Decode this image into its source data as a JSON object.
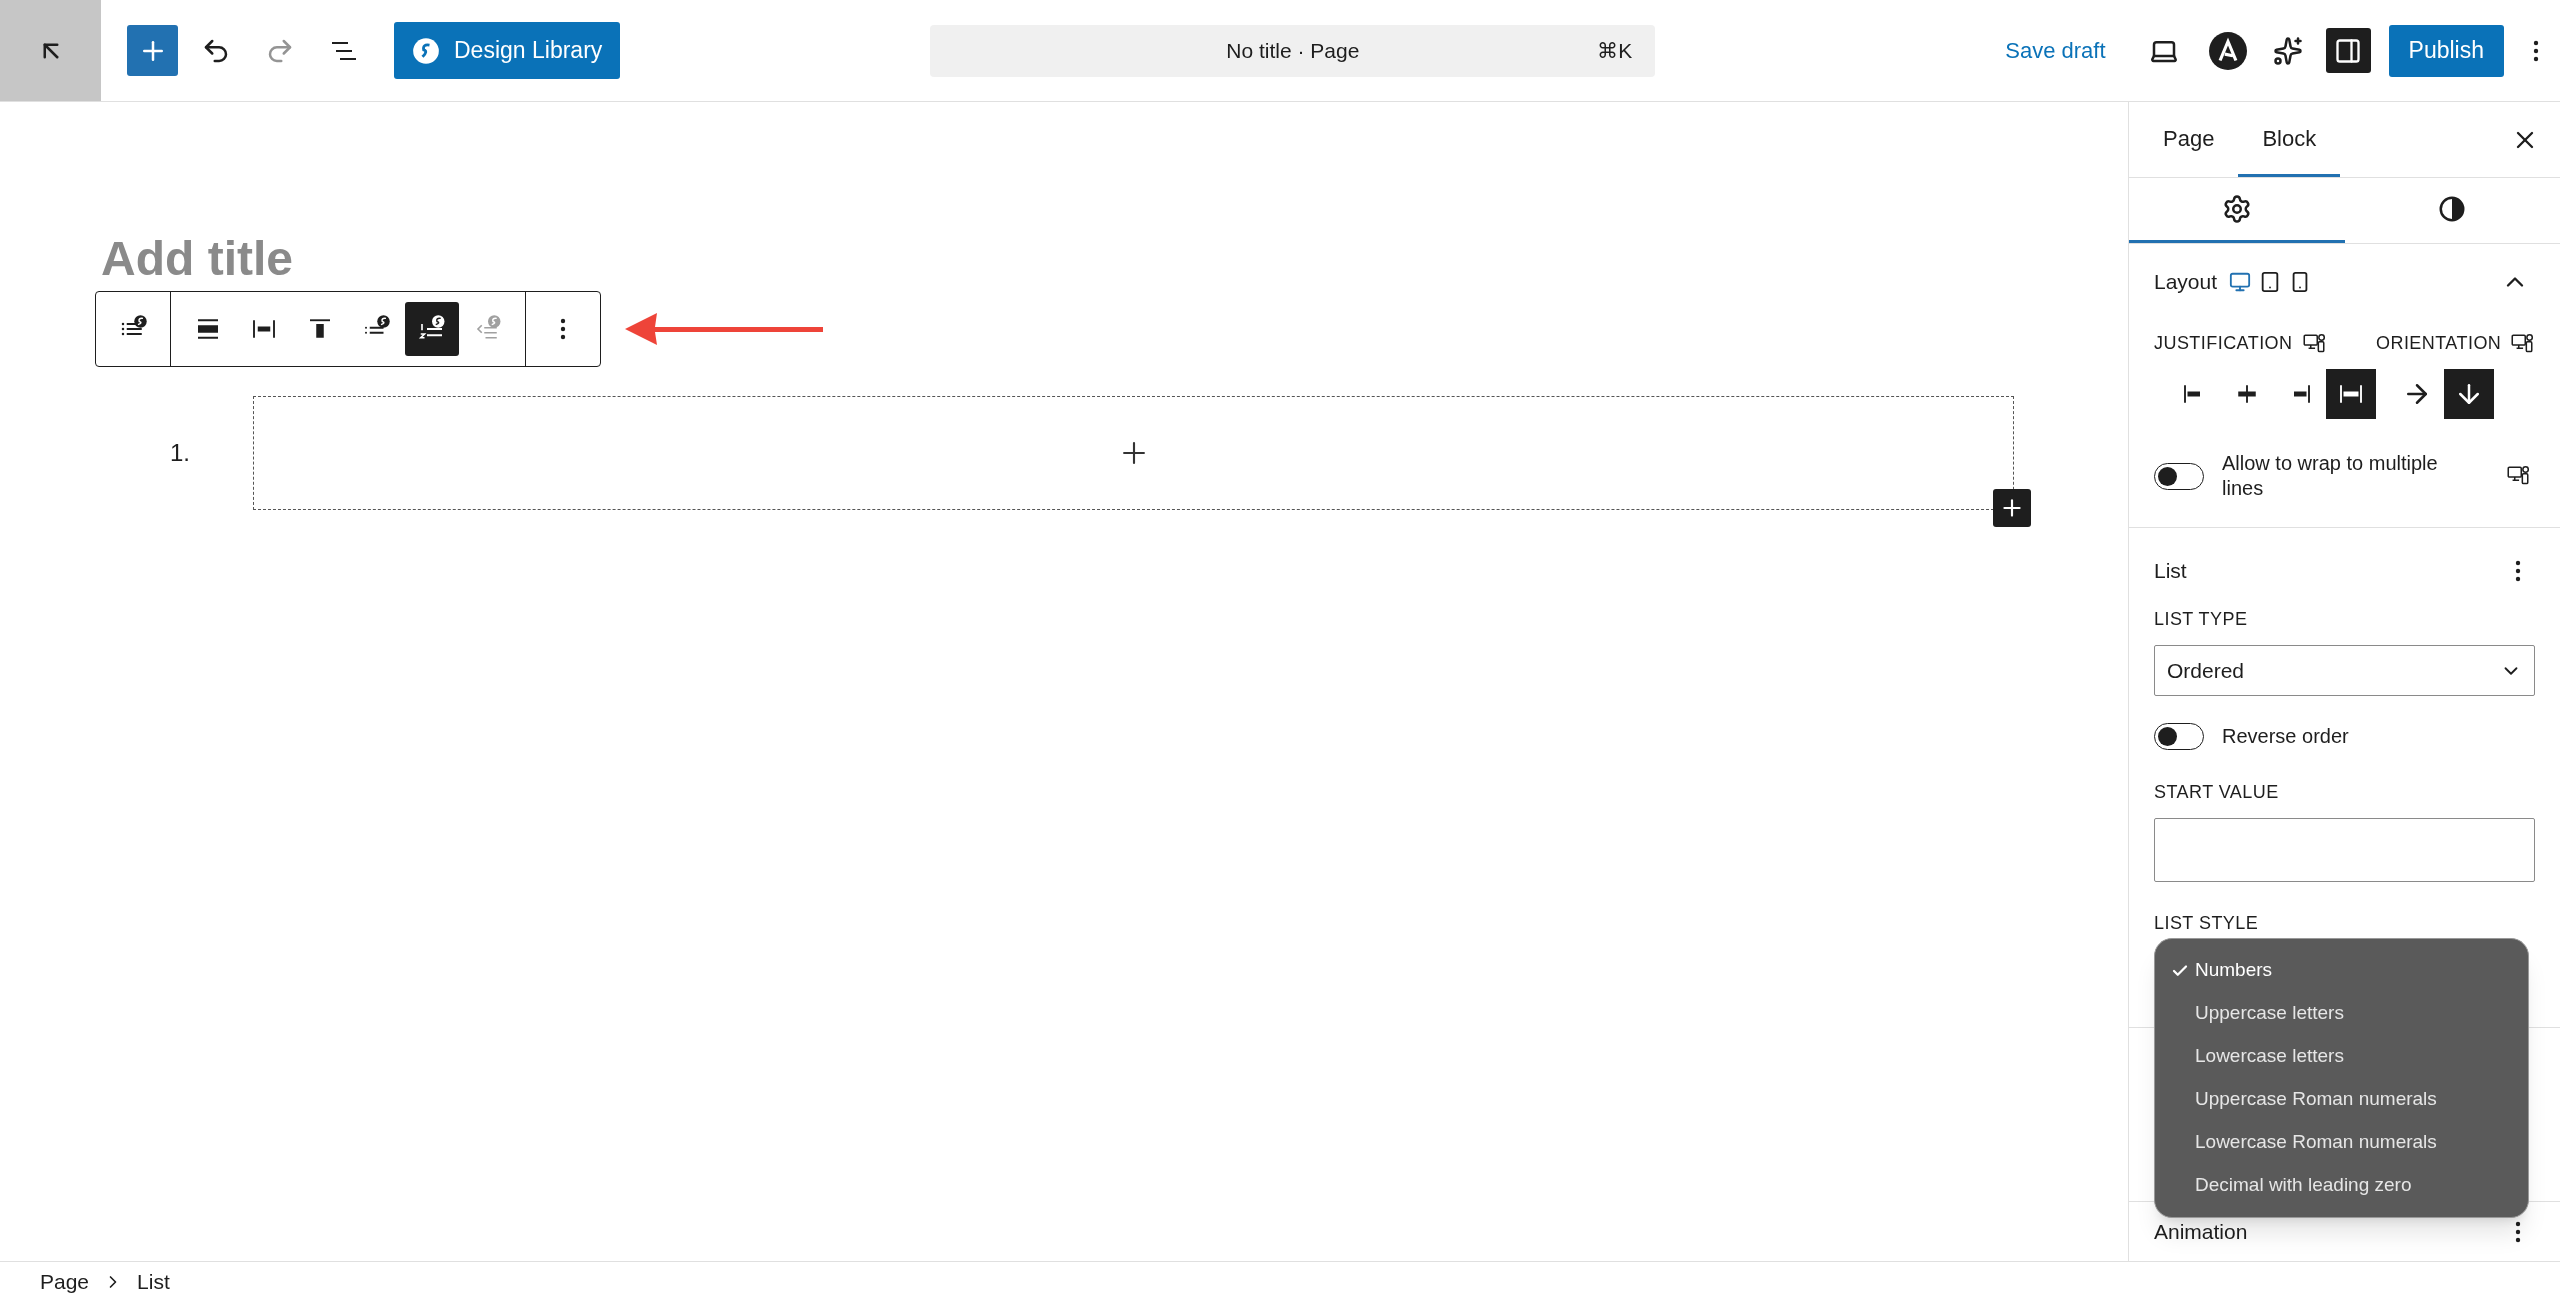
{
  "top_bar": {
    "design_library": "Design Library",
    "command_bar": {
      "title": "No title · Page",
      "shortcut": "⌘K"
    },
    "save_draft": "Save draft",
    "sidebar_toggle": {
      "selected": true
    },
    "publish": "Publish"
  },
  "editor": {
    "title_placeholder": "Add title",
    "block_toolbar": {
      "groups": [
        {
          "tools": [
            {
              "kind": "block-type",
              "selected": false,
              "disabled": false
            }
          ]
        },
        {
          "tools": [
            {
              "kind": "wide-bar",
              "selected": false,
              "disabled": false
            },
            {
              "kind": "spaced-bar",
              "selected": false,
              "disabled": false
            },
            {
              "kind": "top-bar",
              "selected": false,
              "disabled": false
            },
            {
              "kind": "unordered",
              "selected": false,
              "disabled": false
            },
            {
              "kind": "ordered",
              "selected": true,
              "disabled": false
            },
            {
              "kind": "outdent",
              "selected": false,
              "disabled": true
            }
          ]
        },
        {
          "tools": [
            {
              "kind": "more",
              "selected": false,
              "disabled": false
            }
          ]
        }
      ]
    },
    "list_items": [
      {
        "marker": "1."
      }
    ]
  },
  "sidebar": {
    "tabs": [
      {
        "label": "Page",
        "selected": false
      },
      {
        "label": "Block",
        "selected": true
      }
    ],
    "icon_tabs": [
      {
        "kind": "settings",
        "selected": true
      },
      {
        "kind": "styles",
        "selected": false
      }
    ],
    "layout": {
      "title": "Layout",
      "expanded": true,
      "devices": [
        {
          "kind": "desktop",
          "selected": true
        },
        {
          "kind": "tablet",
          "selected": false
        },
        {
          "kind": "mobile",
          "selected": false
        }
      ],
      "justification": {
        "label": "JUSTIFICATION",
        "options": [
          {
            "kind": "left",
            "selected": false
          },
          {
            "kind": "center",
            "selected": false
          },
          {
            "kind": "right",
            "selected": false
          },
          {
            "kind": "stretch",
            "selected": true
          }
        ]
      },
      "orientation": {
        "label": "ORIENTATION",
        "options": [
          {
            "kind": "horizontal",
            "selected": false
          },
          {
            "kind": "vertical",
            "selected": true
          }
        ]
      },
      "wrap": {
        "label": "Allow to wrap to multiple lines",
        "on": false
      }
    },
    "list": {
      "title": "List",
      "list_type": {
        "label": "LIST TYPE",
        "value": "Ordered"
      },
      "reverse": {
        "label": "Reverse order",
        "on": false
      },
      "start_value": {
        "label": "START VALUE"
      },
      "list_style": {
        "label": "LIST STYLE",
        "options": [
          {
            "label": "Numbers",
            "selected": true
          },
          {
            "label": "Uppercase letters",
            "selected": false
          },
          {
            "label": "Lowercase letters",
            "selected": false
          },
          {
            "label": "Uppercase Roman numerals",
            "selected": false
          },
          {
            "label": "Lowercase Roman numerals",
            "selected": false
          },
          {
            "label": "Decimal with leading zero",
            "selected": false
          }
        ]
      }
    },
    "animation": {
      "title": "Animation"
    }
  },
  "breadcrumb": [
    "Page",
    "List"
  ]
}
